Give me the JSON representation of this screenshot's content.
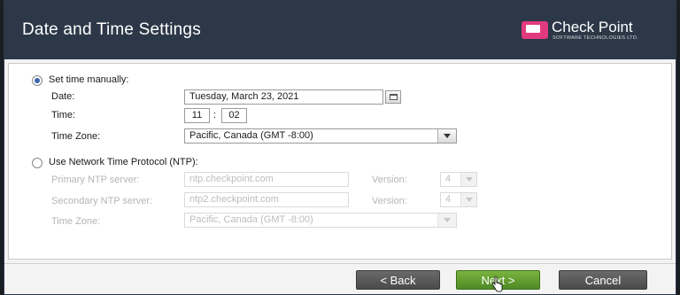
{
  "header": {
    "title": "Date and Time Settings",
    "logo": {
      "name": "Check Point",
      "tagline": "SOFTWARE TECHNOLOGIES LTD.",
      "color": "#e23a7e"
    }
  },
  "manual": {
    "label": "Set time manually:",
    "selected": true,
    "date_label": "Date:",
    "date_value": "Tuesday, March 23, 2021",
    "time_label": "Time:",
    "hour": "11",
    "separator": ":",
    "minute": "02",
    "tz_label": "Time Zone:",
    "tz_value": "Pacific, Canada (GMT -8:00)"
  },
  "ntp": {
    "label": "Use Network Time Protocol (NTP):",
    "selected": false,
    "primary_label": "Primary NTP server:",
    "primary_value": "ntp.checkpoint.com",
    "secondary_label": "Secondary NTP server:",
    "secondary_value": "ntp2.checkpoint.com",
    "version_label": "Version:",
    "primary_version": "4",
    "secondary_version": "4",
    "tz_label": "Time Zone:",
    "tz_value": "Pacific, Canada (GMT -8:00)"
  },
  "footer": {
    "back_label": "< Back",
    "next_label": "Next >",
    "cancel_label": "Cancel"
  },
  "colors": {
    "header_bg": "#2c3848",
    "next_bg": "#5e9b2f",
    "button_bg": "#555555"
  }
}
